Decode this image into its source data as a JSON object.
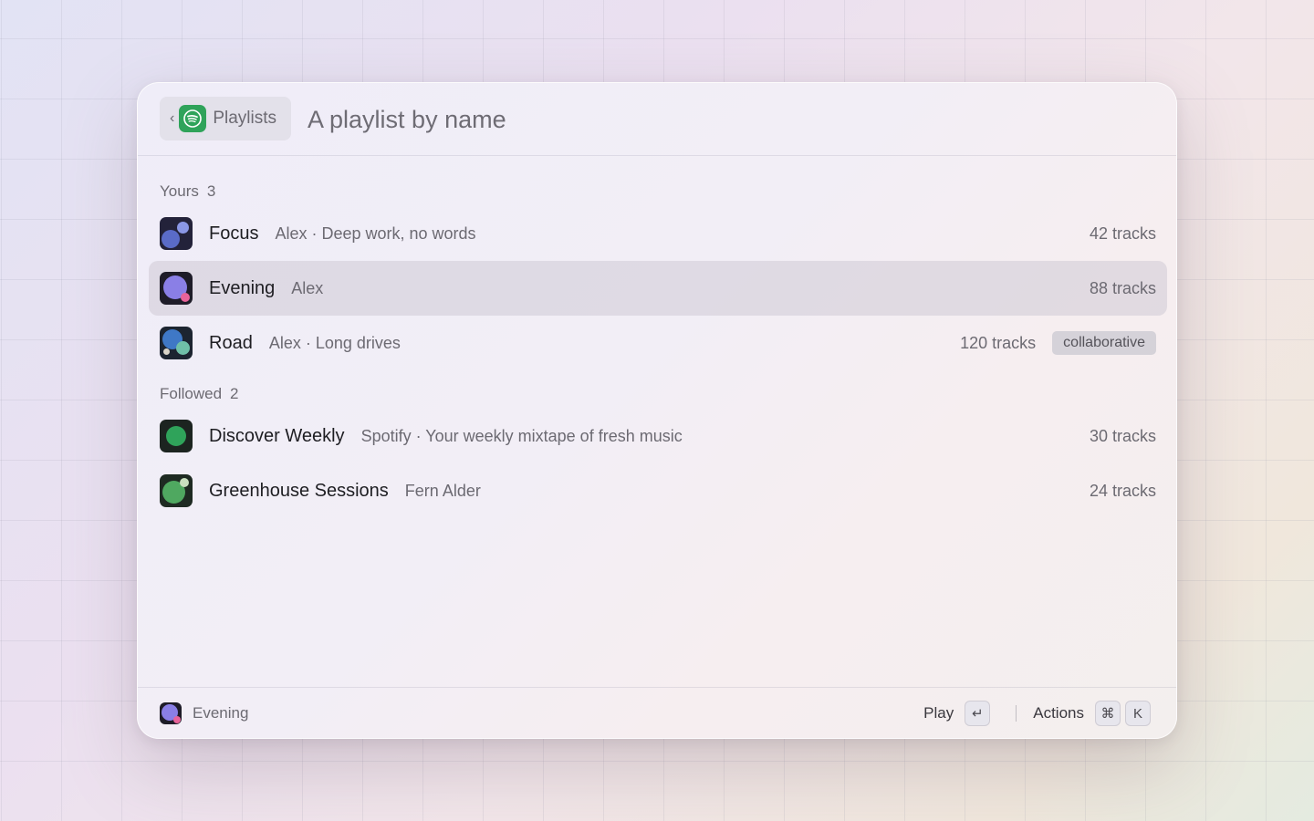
{
  "header": {
    "back_chevron": "‹",
    "back_label": "Playlists",
    "logo_icon": "spotify-logo-icon",
    "search_placeholder": "A playlist by name"
  },
  "sections": [
    {
      "label": "Yours",
      "count": "3",
      "items": [
        {
          "title": "Focus",
          "subtitle": "Alex · Deep work, no words",
          "tracks": "42 tracks",
          "selected": false
        },
        {
          "title": "Evening",
          "subtitle": "Alex",
          "tracks": "88 tracks",
          "selected": true
        },
        {
          "title": "Road",
          "subtitle": "Alex · Long drives",
          "tracks": "120 tracks",
          "badge": "collaborative",
          "selected": false
        }
      ]
    },
    {
      "label": "Followed",
      "count": "2",
      "items": [
        {
          "title": "Discover Weekly",
          "subtitle": "Spotify · Your weekly mixtape of fresh music",
          "tracks": "30 tracks",
          "selected": false
        },
        {
          "title": "Greenhouse Sessions",
          "subtitle": "Fern Alder",
          "tracks": "24 tracks",
          "selected": false
        }
      ]
    }
  ],
  "footer": {
    "selected_label": "Evening",
    "play_label": "Play",
    "play_key": "↵",
    "actions_label": "Actions",
    "actions_keys": [
      "⌘",
      "K"
    ]
  },
  "colors": {
    "accent_green": "#2fa35a",
    "selected_row": "#ddd8df"
  }
}
